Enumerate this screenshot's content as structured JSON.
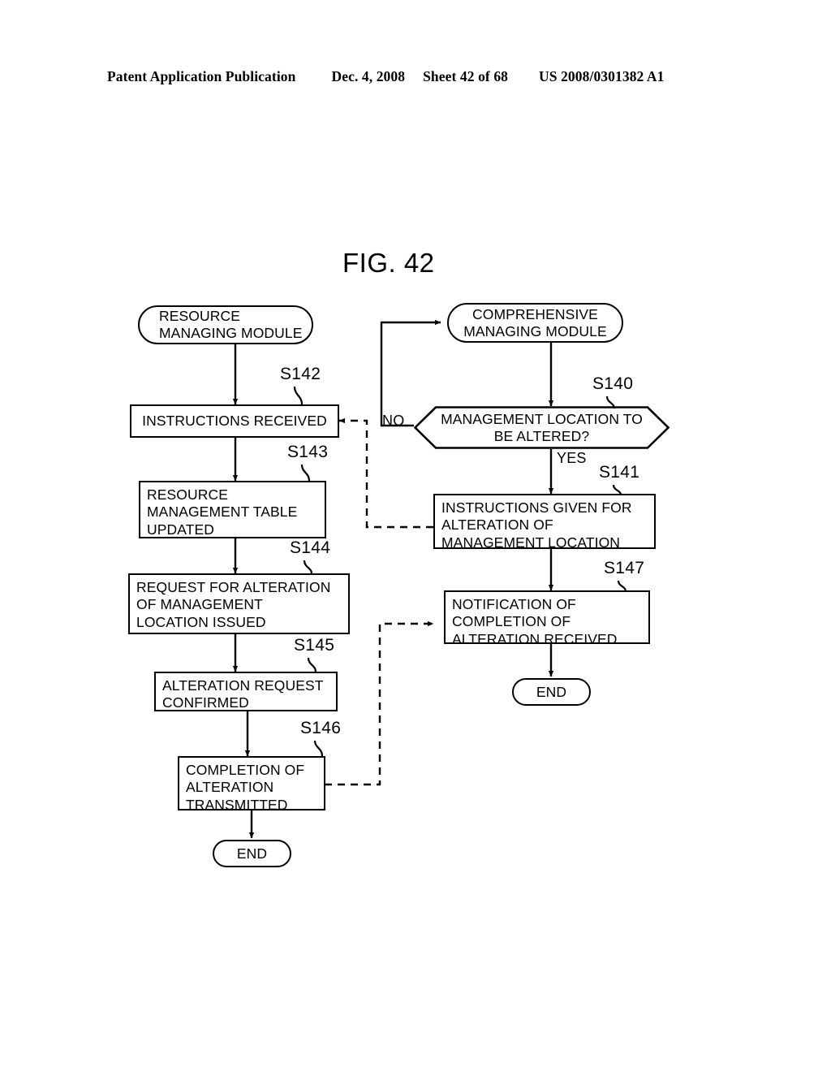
{
  "header": {
    "publication": "Patent Application Publication",
    "date": "Dec. 4, 2008",
    "sheet": "Sheet 42 of 68",
    "patent_number": "US 2008/0301382 A1"
  },
  "figure": {
    "title": "FIG. 42"
  },
  "diagram": {
    "type": "flowchart",
    "columns": [
      {
        "name": "left-lane",
        "start_label": "RESOURCE MANAGING MODULE"
      },
      {
        "name": "right-lane",
        "start_label": "COMPREHENSIVE MANAGING MODULE"
      }
    ],
    "nodes": [
      {
        "id": "resource-managing-module",
        "shape": "terminator",
        "lines": [
          "RESOURCE",
          "MANAGING MODULE"
        ],
        "step": ""
      },
      {
        "id": "comprehensive-managing-module",
        "shape": "terminator",
        "lines": [
          "COMPREHENSIVE",
          "MANAGING MODULE"
        ],
        "step": ""
      },
      {
        "id": "s140-decision",
        "shape": "decision",
        "lines": [
          "MANAGEMENT LOCATION TO",
          "BE ALTERED?"
        ],
        "step": "S140"
      },
      {
        "id": "s141-instructions-given",
        "shape": "process",
        "lines": [
          "INSTRUCTIONS GIVEN FOR",
          "ALTERATION OF",
          "MANAGEMENT LOCATION"
        ],
        "step": "S141"
      },
      {
        "id": "s142-instructions-received",
        "shape": "process",
        "lines": [
          "INSTRUCTIONS RECEIVED"
        ],
        "step": "S142"
      },
      {
        "id": "s143-resource-table-updated",
        "shape": "process",
        "lines": [
          "RESOURCE",
          "MANAGEMENT TABLE",
          "UPDATED"
        ],
        "step": "S143"
      },
      {
        "id": "s144-request-for-alteration",
        "shape": "process",
        "lines": [
          "REQUEST FOR ALTERATION",
          "OF MANAGEMENT",
          "LOCATION ISSUED"
        ],
        "step": "S144"
      },
      {
        "id": "s145-alteration-request-confirmed",
        "shape": "process",
        "lines": [
          "ALTERATION REQUEST",
          "CONFIRMED"
        ],
        "step": "S145"
      },
      {
        "id": "s146-completion-transmitted",
        "shape": "process",
        "lines": [
          "COMPLETION OF",
          "ALTERATION",
          "TRANSMITTED"
        ],
        "step": "S146"
      },
      {
        "id": "s147-notification-received",
        "shape": "process",
        "lines": [
          "NOTIFICATION OF",
          "COMPLETION OF",
          "ALTERATION RECEIVED"
        ],
        "step": "S147"
      },
      {
        "id": "end-left",
        "shape": "terminator",
        "lines": [
          "END"
        ],
        "step": ""
      },
      {
        "id": "end-right",
        "shape": "terminator",
        "lines": [
          "END"
        ],
        "step": ""
      }
    ],
    "branch_labels": {
      "no": "NO",
      "yes": "YES"
    },
    "step_ids": {
      "s140": "S140",
      "s141": "S141",
      "s142": "S142",
      "s143": "S143",
      "s144": "S144",
      "s145": "S145",
      "s146": "S146",
      "s147": "S147"
    },
    "edges": [
      {
        "from": "comprehensive-managing-module",
        "to": "s140-decision",
        "style": "solid"
      },
      {
        "from": "s140-decision",
        "to": "comprehensive-managing-module",
        "style": "solid",
        "label": "NO"
      },
      {
        "from": "s140-decision",
        "to": "s141-instructions-given",
        "style": "solid",
        "label": "YES"
      },
      {
        "from": "s141-instructions-given",
        "to": "s142-instructions-received",
        "style": "dashed"
      },
      {
        "from": "s141-instructions-given",
        "to": "s147-notification-received",
        "style": "solid"
      },
      {
        "from": "s147-notification-received",
        "to": "end-right",
        "style": "solid"
      },
      {
        "from": "resource-managing-module",
        "to": "s142-instructions-received",
        "style": "solid"
      },
      {
        "from": "s142-instructions-received",
        "to": "s143-resource-table-updated",
        "style": "solid"
      },
      {
        "from": "s143-resource-table-updated",
        "to": "s144-request-for-alteration",
        "style": "solid"
      },
      {
        "from": "s144-request-for-alteration",
        "to": "s145-alteration-request-confirmed",
        "style": "solid"
      },
      {
        "from": "s145-alteration-request-confirmed",
        "to": "s146-completion-transmitted",
        "style": "solid"
      },
      {
        "from": "s146-completion-transmitted",
        "to": "end-left",
        "style": "solid"
      },
      {
        "from": "s146-completion-transmitted",
        "to": "s147-notification-received",
        "style": "dashed"
      }
    ]
  },
  "colors": {
    "ink": "#000000",
    "paper": "#ffffff"
  }
}
